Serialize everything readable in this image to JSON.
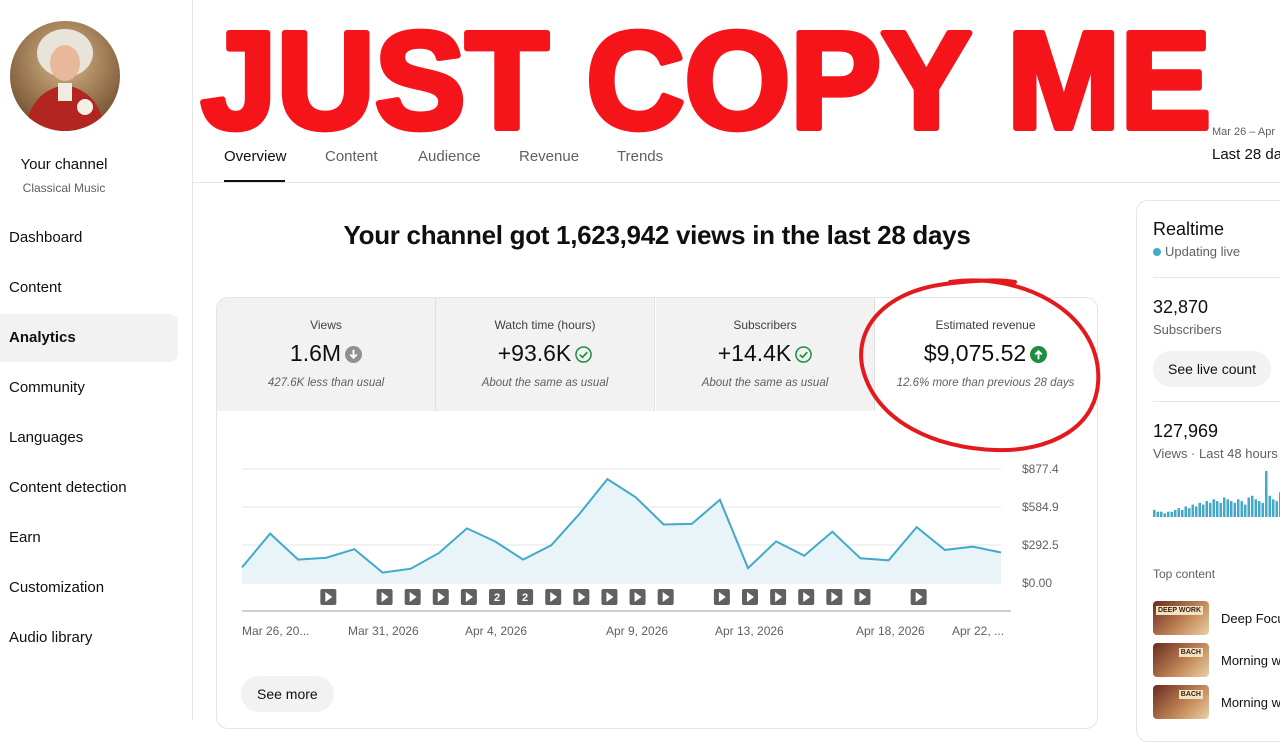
{
  "headline": "JUST COPY ME",
  "sidebar": {
    "channel_name": "Your channel",
    "channel_category": "Classical Music",
    "items": [
      {
        "label": "Dashboard"
      },
      {
        "label": "Content"
      },
      {
        "label": "Analytics"
      },
      {
        "label": "Community"
      },
      {
        "label": "Languages"
      },
      {
        "label": "Content detection"
      },
      {
        "label": "Earn"
      },
      {
        "label": "Customization"
      },
      {
        "label": "Audio library"
      }
    ]
  },
  "tabs": [
    {
      "label": "Overview"
    },
    {
      "label": "Content"
    },
    {
      "label": "Audience"
    },
    {
      "label": "Revenue"
    },
    {
      "label": "Trends"
    }
  ],
  "date_range": {
    "range": "Mar 26 – Apr",
    "label": "Last 28 da"
  },
  "summary": "Your channel got 1,623,942 views in the last 28 days",
  "metrics": [
    {
      "label": "Views",
      "value": "1.6M",
      "note": "427.6K less than usual",
      "icon": "arrow-down-circle-icon"
    },
    {
      "label": "Watch time (hours)",
      "value": "+93.6K",
      "note": "About the same as usual",
      "icon": "check-circle-icon"
    },
    {
      "label": "Subscribers",
      "value": "+14.4K",
      "note": "About the same as usual",
      "icon": "check-circle-icon"
    },
    {
      "label": "Estimated revenue",
      "value": "$9,075.52",
      "note": "12.6% more than previous 28 days",
      "icon": "arrow-up-circle-icon"
    }
  ],
  "colors": {
    "line": "#41a9c9",
    "fill": "#e8f4f8",
    "up": "#1e8e3e",
    "circle": "#e3191e",
    "headline": "#f4141a"
  },
  "chart_data": {
    "type": "area",
    "ylim": [
      0,
      877.4
    ],
    "y_ticks": [
      "$877.4",
      "$584.9",
      "$292.5",
      "$0.00"
    ],
    "x_tick_labels": [
      "Mar 26, 20...",
      "Mar 31, 2026",
      "Apr 4, 2026",
      "Apr 9, 2026",
      "Apr 13, 2026",
      "Apr 18, 2026",
      "Apr 22, ..."
    ],
    "values": [
      120,
      380,
      180,
      195,
      260,
      80,
      110,
      230,
      420,
      320,
      180,
      290,
      530,
      800,
      660,
      450,
      455,
      640,
      115,
      320,
      210,
      395,
      190,
      175,
      430,
      255,
      280,
      235
    ],
    "markers": [
      {
        "day": 3,
        "label": ""
      },
      {
        "day": 5,
        "label": ""
      },
      {
        "day": 6,
        "label": ""
      },
      {
        "day": 7,
        "label": ""
      },
      {
        "day": 8,
        "label": ""
      },
      {
        "day": 9,
        "label": "2"
      },
      {
        "day": 10,
        "label": "2"
      },
      {
        "day": 11,
        "label": ""
      },
      {
        "day": 12,
        "label": ""
      },
      {
        "day": 13,
        "label": ""
      },
      {
        "day": 14,
        "label": ""
      },
      {
        "day": 15,
        "label": ""
      },
      {
        "day": 17,
        "label": ""
      },
      {
        "day": 18,
        "label": ""
      },
      {
        "day": 19,
        "label": ""
      },
      {
        "day": 20,
        "label": ""
      },
      {
        "day": 21,
        "label": ""
      },
      {
        "day": 22,
        "label": ""
      },
      {
        "day": 24,
        "label": ""
      }
    ]
  },
  "see_more": "See more",
  "realtime": {
    "title": "Realtime",
    "live_label": "Updating live",
    "subscribers_value": "32,870",
    "subscribers_label": "Subscribers",
    "see_live_count": "See live count",
    "views_value": "127,969",
    "views_label": "Views · Last 48 hours",
    "bars": [
      4,
      3,
      3,
      2,
      3,
      3,
      4,
      5,
      4,
      6,
      5,
      7,
      6,
      8,
      7,
      9,
      8,
      10,
      9,
      8,
      11,
      10,
      9,
      8,
      10,
      9,
      7,
      11,
      12,
      10,
      9,
      8,
      26,
      12,
      10,
      9,
      14,
      13,
      12,
      16,
      18
    ],
    "top_content_label": "Top content",
    "top_content": [
      {
        "title": "Deep Focu",
        "thumb": "DEEP WORK"
      },
      {
        "title": "Morning w",
        "thumb": "BACH"
      },
      {
        "title": "Morning w",
        "thumb": "BACH"
      }
    ]
  }
}
